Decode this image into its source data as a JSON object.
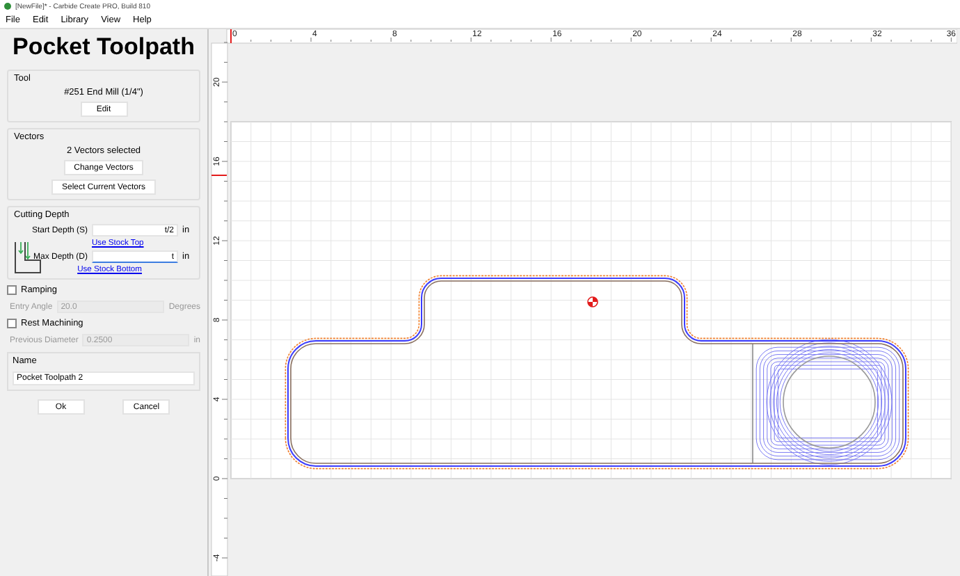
{
  "window": {
    "title": "[NewFile]* - Carbide Create PRO, Build 810"
  },
  "menu": [
    "File",
    "Edit",
    "Library",
    "View",
    "Help"
  ],
  "panel": {
    "title": "Pocket Toolpath",
    "tool": {
      "label": "Tool",
      "name": "#251 End Mill (1/4\")",
      "button": "Edit"
    },
    "vectors": {
      "label": "Vectors",
      "status": "2 Vectors selected",
      "buttons": [
        "Change Vectors",
        "Select Current Vectors"
      ]
    },
    "cutting_depth": {
      "label": "Cutting Depth",
      "fields": [
        {
          "label": "Start Depth (S)",
          "value": "t/2",
          "unit": "in",
          "focused": false,
          "link": "Use Stock Top"
        },
        {
          "label": "Max Depth (D)",
          "value": "t",
          "unit": "in",
          "focused": true,
          "link": "Use Stock Bottom"
        }
      ]
    },
    "options": [
      {
        "label": "Ramping",
        "checked": false,
        "field": {
          "label": "Entry Angle",
          "value": "20.0",
          "unit": "Degrees",
          "disabled": true
        }
      },
      {
        "label": "Rest Machining",
        "checked": false,
        "field": {
          "label": "Previous Diameter",
          "value": "0.2500",
          "unit": "in",
          "disabled": true
        }
      }
    ],
    "name": {
      "label": "Name",
      "value": "Pocket Toolpath 2"
    },
    "buttons": [
      "Ok",
      "Cancel"
    ]
  },
  "ruler_top": {
    "labels": [
      "0",
      "4",
      "8",
      "12",
      "16",
      "20",
      "24",
      "28",
      "32",
      "36"
    ]
  },
  "ruler_left": {
    "labels": [
      "20",
      "16",
      "12",
      "8",
      "4",
      "0",
      "-4"
    ]
  }
}
